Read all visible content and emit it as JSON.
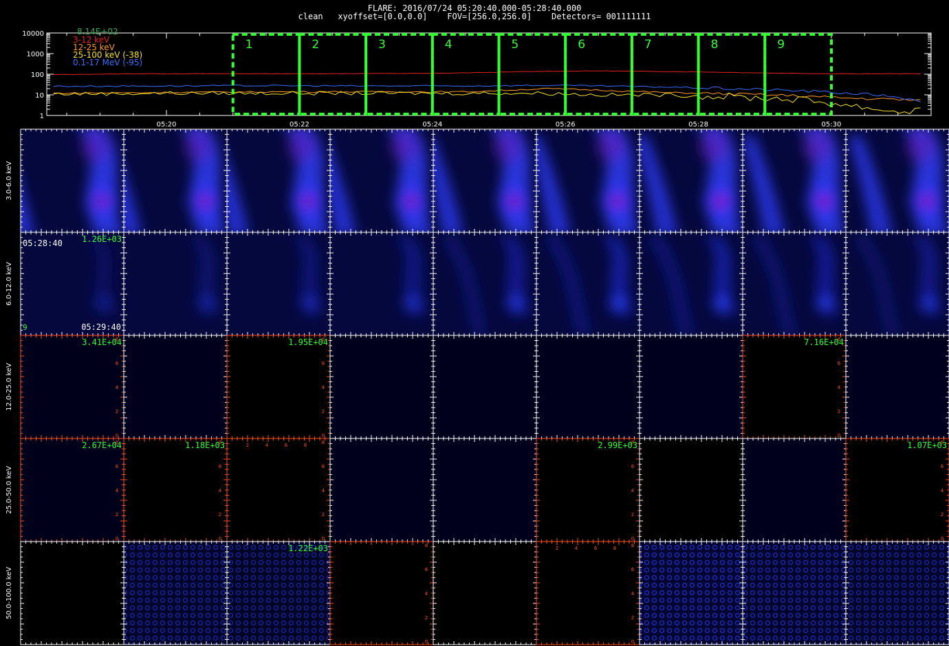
{
  "header": {
    "title_line": "FLARE: 2016/07/24 05:20:40.000-05:28:40.000",
    "info_line": "clean   xyoffset=[0.0,0.0]    FOV=[256.0,256.0]    Detectors= 001111111"
  },
  "chart_data": [
    {
      "type": "line",
      "y_scale": "log",
      "ylim": [
        1,
        10000
      ],
      "y_ticks": [
        "1",
        "10",
        "100",
        "1000",
        "10000"
      ],
      "x_ticks": [
        "05:20",
        "05:22",
        "05:24",
        "05:26",
        "05:28",
        "05:30"
      ],
      "x_tick_minutes": [
        20,
        22,
        24,
        26,
        28,
        30
      ],
      "xlim_minutes": [
        18.2,
        31.5
      ],
      "max_label": "8.14E+02",
      "series": [
        {
          "name": "3-12 keV",
          "color": "#e52020",
          "x": [
            18.3,
            19.5,
            20.7,
            22,
            23,
            24,
            25,
            25.7,
            26.5,
            27.5,
            28,
            29,
            30,
            31.4
          ],
          "y": [
            95,
            105,
            105,
            105,
            108,
            110,
            125,
            140,
            145,
            135,
            130,
            115,
            105,
            105
          ]
        },
        {
          "name": "12-25 keV",
          "color": "#ff9a28",
          "x": [
            18.3,
            20,
            21.5,
            23,
            24.5,
            25.7,
            26.5,
            27.5,
            28.5,
            29.5,
            30.2,
            31,
            31.4
          ],
          "y": [
            12,
            13,
            14,
            14,
            14,
            20,
            17,
            13,
            11,
            9,
            7,
            6,
            5
          ]
        },
        {
          "name": "25-100 keV (-38)",
          "color": "#f5e32b",
          "x": [
            18.3,
            20,
            21.5,
            23,
            24.5,
            25.7,
            26.5,
            27.5,
            28.5,
            29.5,
            30,
            30.5,
            31,
            31.4
          ],
          "y": [
            11,
            12,
            12,
            12,
            12,
            12,
            10,
            10,
            8,
            6,
            4,
            2.5,
            1.5,
            2
          ]
        },
        {
          "name": "0.1-17 MeV (-95)",
          "color": "#3a6cff",
          "x": [
            18.3,
            20,
            21.5,
            23,
            24.5,
            25.7,
            26.5,
            27.5,
            28.5,
            29.5,
            30.5,
            31,
            31.4
          ],
          "y": [
            26,
            27,
            28,
            27,
            27,
            29,
            27,
            24,
            20,
            16,
            11,
            8,
            4
          ]
        }
      ],
      "intervals": [
        {
          "label": "1",
          "start": 21.0,
          "end": 22.0
        },
        {
          "label": "2",
          "start": 22.0,
          "end": 23.0
        },
        {
          "label": "3",
          "start": 23.0,
          "end": 24.0
        },
        {
          "label": "4",
          "start": 24.0,
          "end": 25.0
        },
        {
          "label": "5",
          "start": 25.0,
          "end": 26.0
        },
        {
          "label": "6",
          "start": 26.0,
          "end": 27.0
        },
        {
          "label": "7",
          "start": 27.0,
          "end": 28.0
        },
        {
          "label": "8",
          "start": 28.0,
          "end": 29.0
        },
        {
          "label": "9",
          "start": 29.0,
          "end": 30.0
        }
      ]
    },
    {
      "type": "heatmap",
      "rows": [
        "3.0-6.0 keV",
        "6.0-12.0 keV",
        "12.0-25.0 keV",
        "25.0-50.0 keV",
        "50.0-100.0 keV"
      ],
      "columns": 9,
      "row_types": [
        "bright",
        "dim",
        "dark",
        "dark",
        "noise"
      ],
      "cell_brightness": [
        [
          0.85,
          0.88,
          0.88,
          0.9,
          0.92,
          0.95,
          1.0,
          0.98,
          0.95
        ],
        [
          0.35,
          0.45,
          0.55,
          0.7,
          0.85,
          1.0,
          1.0,
          0.9,
          0.75
        ],
        [
          0.12,
          0.14,
          0.0,
          0.15,
          0.15,
          0.14,
          0.16,
          0.0,
          0.16
        ],
        [
          0.12,
          0.0,
          0.0,
          0.14,
          0.14,
          0.0,
          0.0,
          0.14,
          0.0
        ],
        [
          0.0,
          0.22,
          0.18,
          0.0,
          0.0,
          0.0,
          0.35,
          0.28,
          0.22
        ]
      ],
      "cell_labels": [
        [
          "",
          "",
          "",
          "",
          "",
          "",
          "",
          "",
          ""
        ],
        [
          "1.26E+03",
          "",
          "",
          "",
          "",
          "",
          "",
          "",
          ""
        ],
        [
          "3.41E+04",
          "",
          "1.95E+04",
          "",
          "",
          "",
          "",
          "7.16E+04",
          ""
        ],
        [
          "2.67E+04",
          "1.18E+03",
          "",
          "",
          "",
          "2.99E+03",
          "",
          "",
          "1.07E+03"
        ],
        [
          "",
          "",
          "1.22E+03",
          "",
          "",
          "",
          "",
          "",
          ""
        ]
      ],
      "orange_axis_cells": [
        [
          2,
          0
        ],
        [
          2,
          2
        ],
        [
          2,
          7
        ],
        [
          3,
          0
        ],
        [
          3,
          1
        ],
        [
          3,
          2
        ],
        [
          3,
          5
        ],
        [
          3,
          8
        ],
        [
          4,
          3
        ],
        [
          4,
          5
        ]
      ],
      "top_tick_labels": [
        "2",
        "4",
        "6",
        "8"
      ],
      "side_tick_labels": [
        "8",
        "6",
        "4",
        "2",
        "0"
      ],
      "time_start": "05:28:40",
      "time_end": "05:29:40",
      "interval_number": "9"
    }
  ]
}
